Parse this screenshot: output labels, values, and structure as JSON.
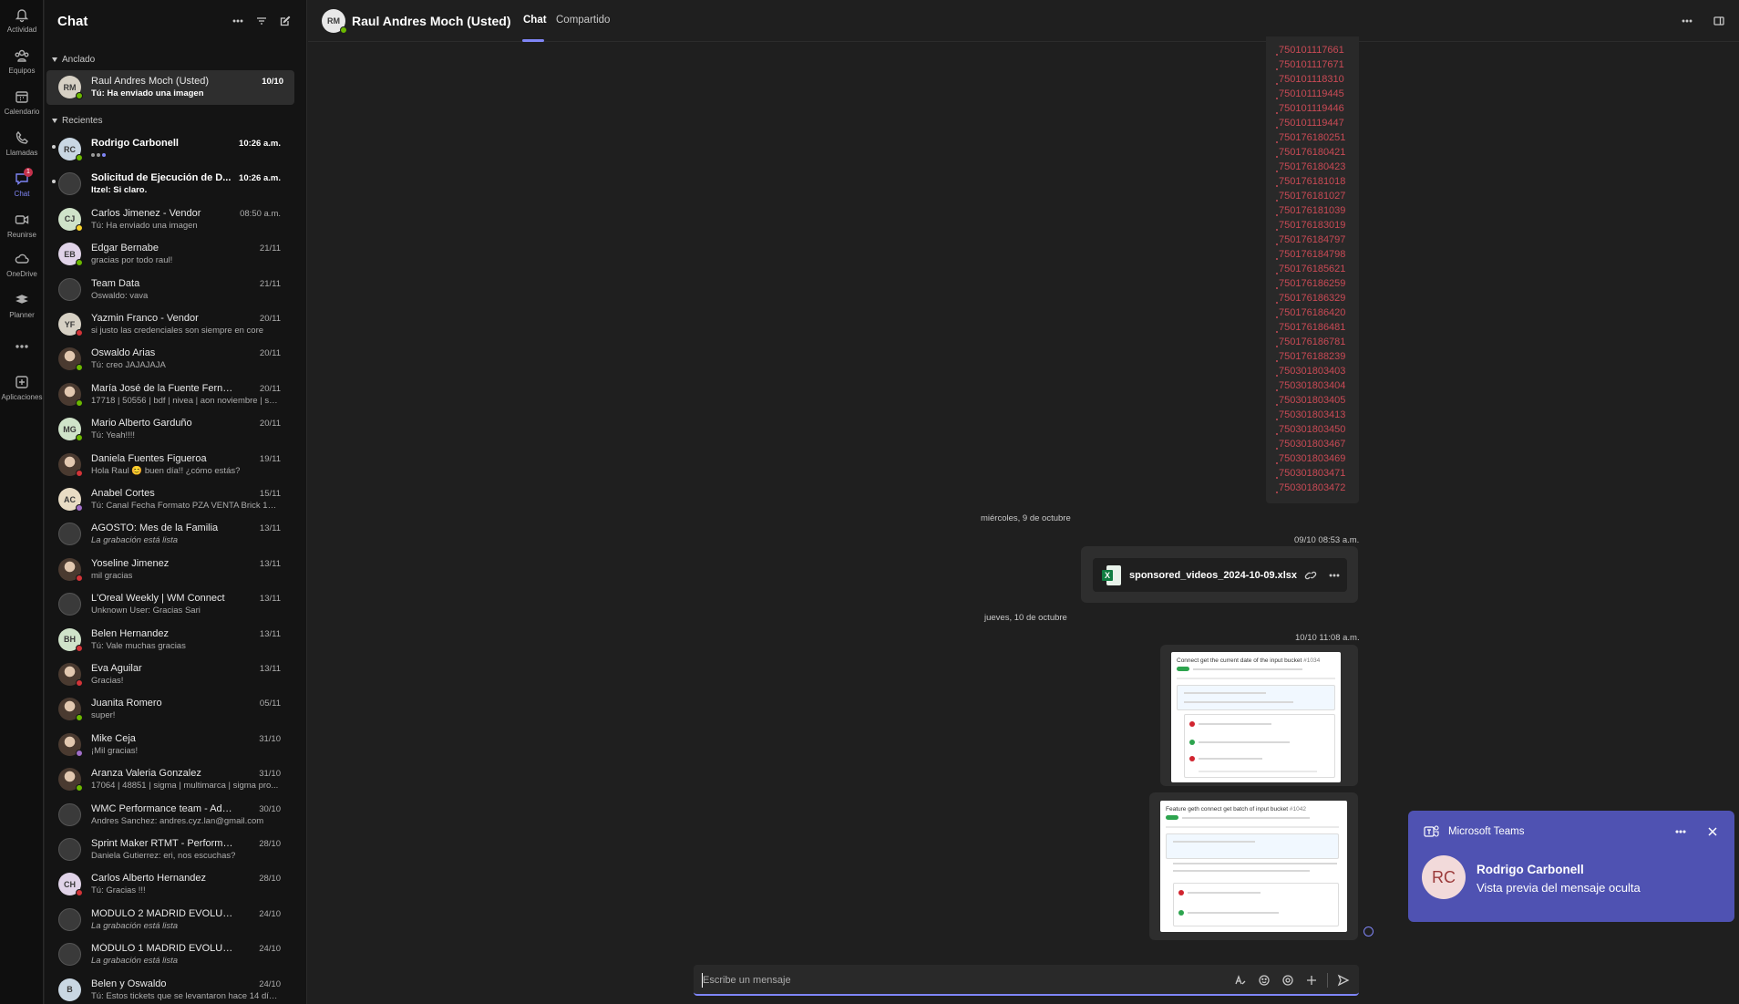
{
  "rail": {
    "items": [
      {
        "label": "Actividad",
        "icon": "bell-icon"
      },
      {
        "label": "Equipos",
        "icon": "teams-icon"
      },
      {
        "label": "Calendario",
        "icon": "calendar-icon"
      },
      {
        "label": "Llamadas",
        "icon": "phone-icon"
      },
      {
        "label": "Chat",
        "icon": "chat-icon",
        "badge": "1"
      },
      {
        "label": "Reunirse",
        "icon": "video-icon"
      },
      {
        "label": "OneDrive",
        "icon": "cloud-icon"
      },
      {
        "label": "Planner",
        "icon": "planner-icon"
      },
      {
        "label": "",
        "icon": "more-icon"
      },
      {
        "label": "Aplicaciones",
        "icon": "add-apps-icon"
      }
    ]
  },
  "chat_list": {
    "title": "Chat",
    "pinned_label": "Anclado",
    "recent_label": "Recientes",
    "pinned": [
      {
        "name": "Raul Andres Moch (Usted)",
        "preview": "Tú: Ha enviado una imagen",
        "time": "10/10",
        "initials": "RM",
        "presence": "green"
      }
    ],
    "recent": [
      {
        "name": "Rodrigo Carbonell",
        "preview": "",
        "time": "10:26 a.m.",
        "initials": "RC",
        "presence": "green",
        "unread": true,
        "typing": true
      },
      {
        "name": "Solicitud de Ejecución de D...",
        "preview": "Itzel: Si claro.",
        "time": "10:26 a.m.",
        "initials": "",
        "presence": "",
        "unread": true
      },
      {
        "name": "Carlos Jimenez - Vendor",
        "preview": "Tú: Ha enviado una imagen",
        "time": "08:50 a.m.",
        "initials": "CJ",
        "presence": "yellow"
      },
      {
        "name": "Edgar Bernabe",
        "preview": "gracias por todo raul!",
        "time": "21/11",
        "initials": "EB",
        "presence": "green"
      },
      {
        "name": "Team Data",
        "preview": "Oswaldo: vava",
        "time": "21/11",
        "initials": "",
        "presence": ""
      },
      {
        "name": "Yazmin Franco - Vendor",
        "preview": "si justo las credenciales son siempre en core",
        "time": "20/11",
        "initials": "YF",
        "presence": "red"
      },
      {
        "name": "Oswaldo Arias",
        "preview": "Tú: creo JAJAJAJA",
        "time": "20/11",
        "initials": "",
        "presence": "green"
      },
      {
        "name": "María José de la Fuente Fernández",
        "preview": "17718 | 50556 | bdf | nivea | aon noviembre | sa...",
        "time": "20/11",
        "initials": "",
        "presence": "green"
      },
      {
        "name": "Mario Alberto Garduño",
        "preview": "Tú: Yeah!!!!",
        "time": "20/11",
        "initials": "MG",
        "presence": "green"
      },
      {
        "name": "Daniela Fuentes Figueroa",
        "preview": "Hola Raul 😊 buen día!! ¿cómo estás?",
        "time": "19/11",
        "initials": "",
        "presence": "red"
      },
      {
        "name": "Anabel Cortes",
        "preview": "Tú: Canal Fecha Formato PZA VENTA Brick 13/1...",
        "time": "15/11",
        "initials": "AC",
        "presence": "purple"
      },
      {
        "name": "AGOSTO: Mes de la Familia",
        "preview": "La grabación está lista",
        "time": "13/11",
        "initials": "",
        "presence": "",
        "italic": true
      },
      {
        "name": "Yoseline Jimenez",
        "preview": "mil gracias",
        "time": "13/11",
        "initials": "",
        "presence": "red"
      },
      {
        "name": "L'Oreal Weekly | WM Connect",
        "preview": "Unknown User: Gracias Sari",
        "time": "13/11",
        "initials": "",
        "presence": ""
      },
      {
        "name": "Belen Hernandez",
        "preview": "Tú: Vale muchas gracias",
        "time": "13/11",
        "initials": "BH",
        "presence": "red"
      },
      {
        "name": "Eva Aguilar",
        "preview": "Gracias!",
        "time": "13/11",
        "initials": "",
        "presence": "red"
      },
      {
        "name": "Juanita Romero",
        "preview": "super!",
        "time": "05/11",
        "initials": "",
        "presence": "green"
      },
      {
        "name": "Mike Ceja",
        "preview": "¡Mil gracias!",
        "time": "31/10",
        "initials": "",
        "presence": "purple"
      },
      {
        "name": "Aranza Valeria Gonzalez",
        "preview": "17064 | 48851 | sigma | multimarca | sigma pro...",
        "time": "31/10",
        "initials": "",
        "presence": "green"
      },
      {
        "name": "WMC Performance team - Adverti...",
        "preview": "Andres Sanchez: andres.cyz.lan@gmail.com",
        "time": "30/10",
        "initials": "",
        "presence": ""
      },
      {
        "name": "Sprint Maker RTMT - Performance",
        "preview": "Daniela Gutierrez: eri, nos escuchas?",
        "time": "28/10",
        "initials": "",
        "presence": ""
      },
      {
        "name": "Carlos Alberto Hernandez",
        "preview": "Tú: Gracias !!!",
        "time": "28/10",
        "initials": "CH",
        "presence": "red"
      },
      {
        "name": "MODULO 2 MADRID EVOLUTION",
        "preview": "La grabación está lista",
        "time": "24/10",
        "initials": "",
        "presence": "",
        "italic": true
      },
      {
        "name": "MÓDULO 1 MADRID EVOLUTION ...",
        "preview": "La grabación está lista",
        "time": "24/10",
        "initials": "",
        "presence": "",
        "italic": true
      },
      {
        "name": "Belen y Oswaldo",
        "preview": "Tú: Estos tickets que se levantaron hace 14 días...",
        "time": "24/10",
        "initials": "B",
        "presence": ""
      }
    ]
  },
  "conversation": {
    "title": "Raul Andres Moch (Usted)",
    "initials": "RM",
    "tabs": [
      "Chat",
      "Compartido"
    ],
    "numbers": [
      "750101117661",
      "750101117671",
      "750101118310",
      "750101119445",
      "750101119446",
      "750101119447",
      "750176180251",
      "750176180421",
      "750176180423",
      "750176181018",
      "750176181027",
      "750176181039",
      "750176183019",
      "750176184797",
      "750176184798",
      "750176185621",
      "750176186259",
      "750176186329",
      "750176186420",
      "750176186481",
      "750176186781",
      "750176188239",
      "750301803403",
      "750301803404",
      "750301803405",
      "750301803413",
      "750301803450",
      "750301803467",
      "750301803469",
      "750301803471",
      "750301803472"
    ],
    "date_sep_1": "miércoles, 9 de octubre",
    "stamp_1": "09/10 08:53 a.m.",
    "file_name": "sponsored_videos_2024-10-09.xlsx",
    "date_sep_2": "jueves, 10 de octubre",
    "stamp_2": "10/10 11:08 a.m.",
    "image_1_title": "Connect get the current date of the input bucket",
    "image_1_ref": "#1034",
    "image_2_title": "Feature geth connect get batch of input bucket",
    "image_2_ref": "#1042",
    "composer_placeholder": "Escribe un mensaje"
  },
  "toast": {
    "app": "Microsoft Teams",
    "sender": "Rodrigo Carbonell",
    "initials": "RC",
    "message": "Vista previa del mensaje oculta"
  },
  "colors": {
    "accent": "#7f85f5",
    "toast": "#4f52b2",
    "numbers": "#c94a55"
  }
}
